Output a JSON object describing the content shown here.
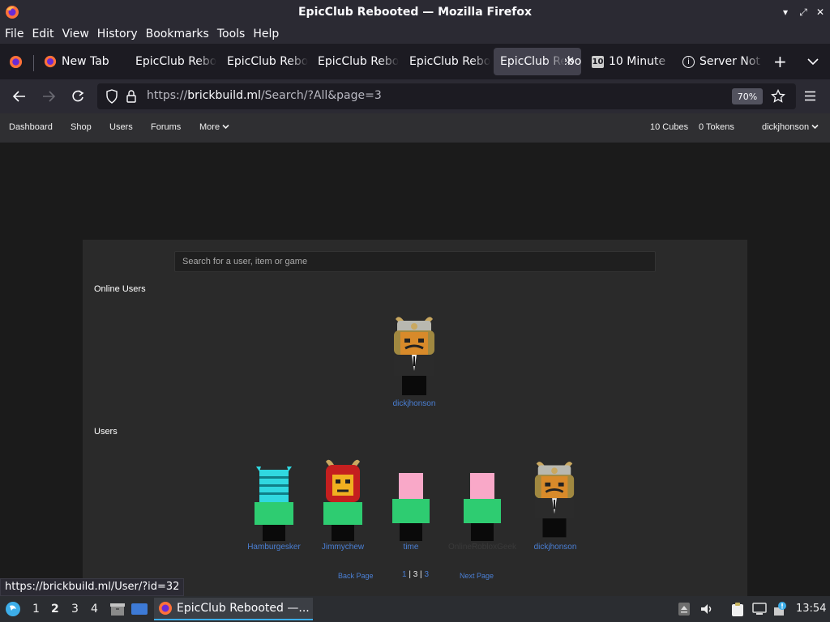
{
  "window": {
    "title": "EpicClub Rebooted — Mozilla Firefox"
  },
  "menu": [
    "File",
    "Edit",
    "View",
    "History",
    "Bookmarks",
    "Tools",
    "Help"
  ],
  "tabs": [
    {
      "label": "New Tab",
      "icon": "firefox-icon"
    },
    {
      "label": "EpicClub Rebooted"
    },
    {
      "label": "EpicClub Rebooted"
    },
    {
      "label": "EpicClub Rebooted"
    },
    {
      "label": "EpicClub Rebooted"
    },
    {
      "label": "EpicClub Rebooted",
      "active": true
    },
    {
      "label": "10 Minute",
      "icon": "ten-icon"
    },
    {
      "label": "Server Not",
      "icon": "info-icon"
    }
  ],
  "navbar": {
    "url_prefix": "https://",
    "url_host": "brickbuild.ml",
    "url_path": "/Search/?All&page=3",
    "zoom": "70%"
  },
  "site": {
    "nav": [
      "Dashboard",
      "Shop",
      "Users",
      "Forums",
      "More"
    ],
    "cubes": "10 Cubes",
    "tokens": "0 Tokens",
    "username": "dickjhonson",
    "search_placeholder": "Search for a user, item or game",
    "online_heading": "Online Users",
    "users_heading": "Users",
    "online_users": [
      {
        "name": "dickjhonson",
        "style": "samurai"
      }
    ],
    "users": [
      {
        "name": "Hamburgesker",
        "style": "cyan"
      },
      {
        "name": "Jimmychew",
        "style": "red-samurai"
      },
      {
        "name": "time",
        "style": "pink"
      },
      {
        "name": "OnlineRobloxGeek",
        "style": "pink",
        "faded": true
      },
      {
        "name": "dickjhonson",
        "style": "samurai"
      }
    ],
    "pagination": {
      "back": "Back Page",
      "pages": [
        "1",
        "3",
        "3"
      ],
      "next": "Next Page"
    }
  },
  "status_url": "https://brickbuild.ml/User/?id=32",
  "taskbar": {
    "workspaces": [
      "1",
      "2",
      "3",
      "4"
    ],
    "active_workspace": "2",
    "task_label": "EpicClub Rebooted —...",
    "clock": "13:54"
  }
}
